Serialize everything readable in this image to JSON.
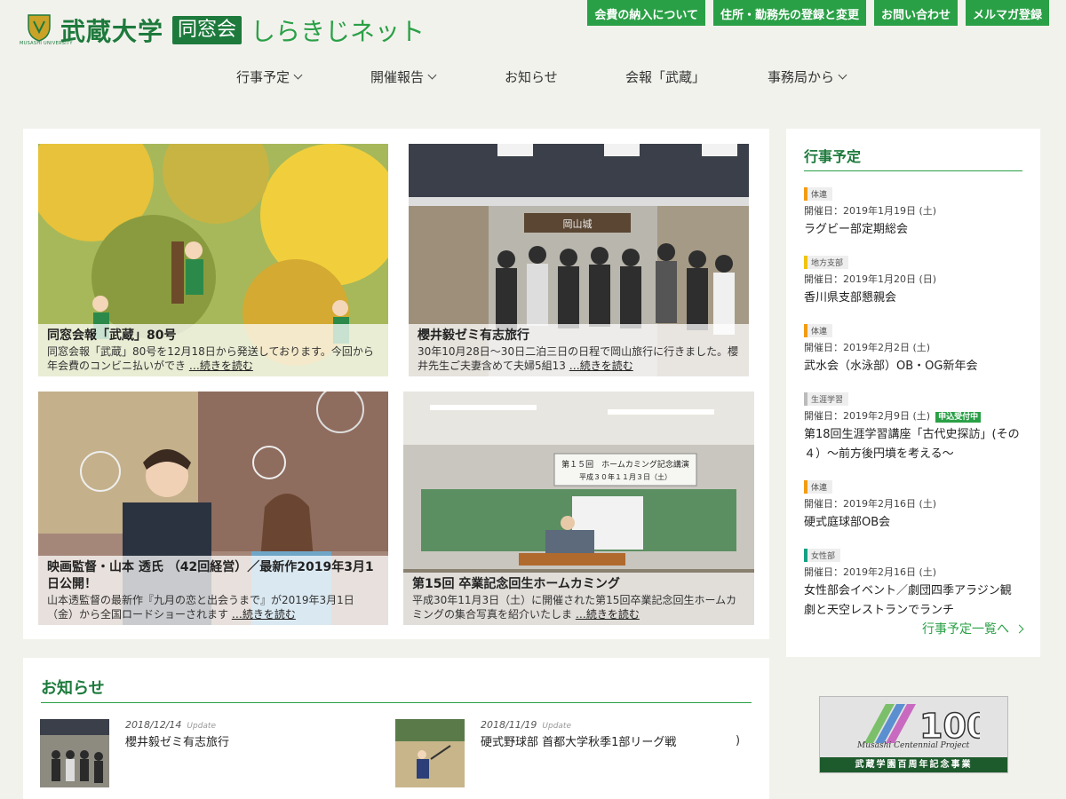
{
  "header": {
    "logo_name": "武蔵大学",
    "logo_box": "同窓会",
    "logo_net": "しらきじネット",
    "logo_university": "MUSASHI UNIVERSITY",
    "top_links": [
      "会費の納入について",
      "住所・勤務先の登録と変更",
      "お問い合わせ",
      "メルマガ登録"
    ]
  },
  "nav": {
    "items": [
      {
        "label": "行事予定",
        "has_dropdown": true
      },
      {
        "label": "開催報告",
        "has_dropdown": true
      },
      {
        "label": "お知らせ",
        "has_dropdown": false
      },
      {
        "label": "会報「武蔵」",
        "has_dropdown": false
      },
      {
        "label": "事務局から",
        "has_dropdown": true
      }
    ]
  },
  "features": [
    {
      "title": "同窓会報「武蔵」80号",
      "desc": "同窓会報「武蔵」80号を12月18日から発送しております。今回から年会費のコンビニ払いができ",
      "more": "…続きを読む"
    },
    {
      "title": "櫻井毅ゼミ有志旅行",
      "desc": "30年10月28日～30日二泊三日の日程で岡山旅行に行きました。櫻井先生ご夫妻含めて夫婦5組13",
      "more": "…続きを読む"
    },
    {
      "title": "映画監督・山本 透氏 （42回経営）／最新作2019年3月1日公開！",
      "desc": "山本透監督の最新作『九月の恋と出会うまで』が2019年3月1日（金）から全国ロードショーされます",
      "more": "…続きを読む"
    },
    {
      "title": "第15回 卒業記念回生ホームカミング",
      "desc": "平成30年11月3日（土）に開催された第15回卒業記念回生ホームカミングの集合写真を紹介いたしま",
      "more": "…続きを読む"
    }
  ],
  "photo_text": {
    "sign": "岡山城",
    "banner_line1": "第１５回　ホームカミング記念講演",
    "banner_line2": "平成３０年１１月３日（土）"
  },
  "sidebar": {
    "heading": "行事予定",
    "events": [
      {
        "tag": "体連",
        "tag_color": "#f39c12",
        "date": "開催日：2019年1月19日 (土)",
        "badge": "",
        "title": "ラグビー部定期総会"
      },
      {
        "tag": "地方支部",
        "tag_color": "#f1c40f",
        "date": "開催日：2019年1月20日 (日)",
        "badge": "",
        "title": "香川県支部懇親会"
      },
      {
        "tag": "体連",
        "tag_color": "#f39c12",
        "date": "開催日：2019年2月2日 (土)",
        "badge": "",
        "title": "武水会（水泳部）OB・OG新年会"
      },
      {
        "tag": "生涯学習",
        "tag_color": "#bbbbbb",
        "date": "開催日：2019年2月9日 (土)",
        "badge": "申込受付中",
        "title": "第18回生涯学習講座「古代史探訪」(その４）～前方後円墳を考える～"
      },
      {
        "tag": "体連",
        "tag_color": "#f39c12",
        "date": "開催日：2019年2月16日 (土)",
        "badge": "",
        "title": "硬式庭球部OB会"
      },
      {
        "tag": "女性部",
        "tag_color": "#16a085",
        "date": "開催日：2019年2月16日 (土)",
        "badge": "",
        "title": "女性部会イベント／劇団四季アラジン観劇と天空レストランでランチ"
      }
    ],
    "all_link": "行事予定一覧へ"
  },
  "news": {
    "heading": "お知らせ",
    "items": [
      {
        "date": "2018/12/14",
        "status": "Update",
        "title": "櫻井毅ゼミ有志旅行"
      },
      {
        "date": "2018/11/19",
        "status": "Update",
        "title": "硬式野球部 首都大学秋季1部リーグ戦"
      }
    ]
  },
  "centennial": {
    "number": "100",
    "subtitle": "Musashi Centennial Project",
    "band": "武蔵学園百周年記念事業"
  }
}
